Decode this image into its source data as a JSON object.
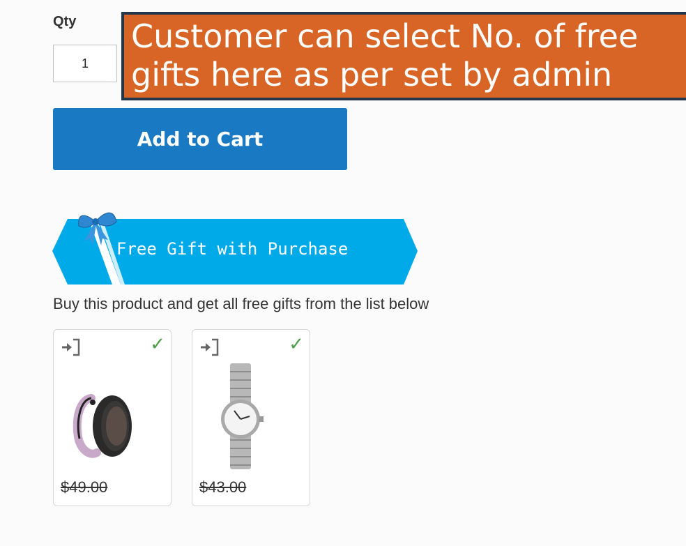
{
  "product": {
    "qty_label": "Qty",
    "qty_value": "1",
    "add_to_cart_label": "Add to Cart"
  },
  "annotation": {
    "line1": "Customer can select No. of free",
    "line2": "gifts here as per set by admin"
  },
  "free_gift": {
    "banner_text": "Free Gift with Purchase",
    "description": "Buy this product and get all free gifts from the list below",
    "gifts": [
      {
        "price": "$49.00",
        "icon": "sign-in-icon",
        "checked": true
      },
      {
        "price": "$43.00",
        "icon": "sign-in-icon",
        "checked": true
      }
    ]
  },
  "colors": {
    "accent": "#1979c3",
    "callout": "#d86425",
    "banner": "#00a9e8",
    "check": "#4a9e45"
  }
}
